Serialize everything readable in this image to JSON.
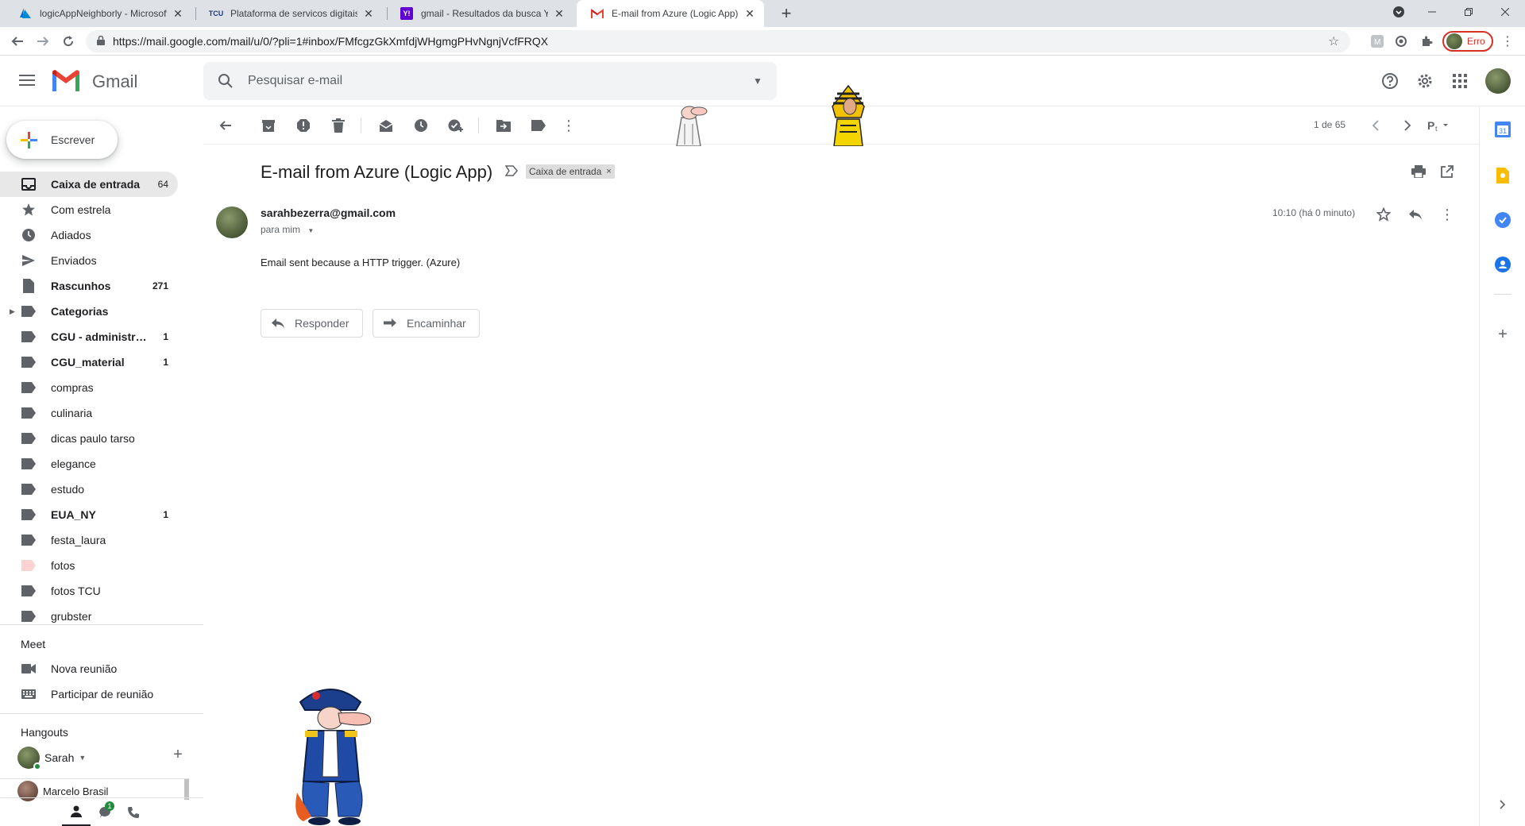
{
  "browser": {
    "tabs": [
      {
        "title": "logicAppNeighborly - Microsoft Azure",
        "favicon": "azure-icon",
        "active": false
      },
      {
        "title": "Plataforma de servicos digitais do TCU",
        "favicon": "tcu-icon",
        "active": false
      },
      {
        "title": "gmail - Resultados da busca Yahoo",
        "favicon": "yahoo-icon",
        "active": false
      },
      {
        "title": "E-mail from Azure (Logic App) - sarahbezerra@gmail.com",
        "favicon": "gmail-icon",
        "active": true
      }
    ],
    "tab_favicon_text": {
      "tcu": "TCU",
      "yahoo": "Y!"
    },
    "url": "https://mail.google.com/mail/u/0/?pli=1#inbox/FMfcgzGkXmfdjWHgmgPHvNgnjVcfFRQX",
    "profile_label": "Erro"
  },
  "gmail": {
    "product_name": "Gmail",
    "search_placeholder": "Pesquisar e-mail",
    "compose_label": "Escrever",
    "nav": [
      {
        "label": "Caixa de entrada",
        "count": "64",
        "icon": "inbox-icon",
        "bold": true,
        "active": true
      },
      {
        "label": "Com estrela",
        "count": "",
        "icon": "star-icon",
        "bold": false
      },
      {
        "label": "Adiados",
        "count": "",
        "icon": "clock-icon",
        "bold": false
      },
      {
        "label": "Enviados",
        "count": "",
        "icon": "send-icon",
        "bold": false
      },
      {
        "label": "Rascunhos",
        "count": "271",
        "icon": "draft-icon",
        "bold": true
      },
      {
        "label": "Categorias",
        "count": "",
        "icon": "label-icon",
        "bold": true,
        "caret": true
      },
      {
        "label": "CGU - administra...",
        "count": "1",
        "icon": "label-icon",
        "bold": true
      },
      {
        "label": "CGU_material",
        "count": "1",
        "icon": "label-icon",
        "bold": true
      },
      {
        "label": "compras",
        "count": "",
        "icon": "label-icon",
        "bold": false
      },
      {
        "label": "culinaria",
        "count": "",
        "icon": "label-icon",
        "bold": false
      },
      {
        "label": "dicas paulo tarso",
        "count": "",
        "icon": "label-icon",
        "bold": false
      },
      {
        "label": "elegance",
        "count": "",
        "icon": "label-icon",
        "bold": false
      },
      {
        "label": "estudo",
        "count": "",
        "icon": "label-icon",
        "bold": false
      },
      {
        "label": "EUA_NY",
        "count": "1",
        "icon": "label-icon",
        "bold": true
      },
      {
        "label": "festa_laura",
        "count": "",
        "icon": "label-icon",
        "bold": false
      },
      {
        "label": "fotos",
        "count": "",
        "icon": "label-pink-icon",
        "bold": false
      },
      {
        "label": "fotos TCU",
        "count": "",
        "icon": "label-icon",
        "bold": false
      },
      {
        "label": "grubster",
        "count": "",
        "icon": "label-icon",
        "bold": false
      }
    ],
    "meet": {
      "heading": "Meet",
      "new_meeting": "Nova reunião",
      "join_meeting": "Participar de reunião"
    },
    "hangouts": {
      "heading": "Hangouts",
      "self_name": "Sarah",
      "contact": "Marcelo Brasil",
      "chat_badge": "1"
    },
    "pager": "1 de 65",
    "message": {
      "subject": "E-mail from Azure (Logic App)",
      "label_chip": "Caixa de entrada",
      "label_chip_close": "×",
      "sender": "sarahbezerra@gmail.com",
      "recipient": "para mim",
      "timestamp": "10:10 (há 0 minuto)",
      "body": "Email sent because a HTTP trigger. (Azure)",
      "reply_label": "Responder",
      "forward_label": "Encaminhar"
    }
  },
  "colors": {
    "gmail_red": "#ea4335",
    "gmail_blue": "#4285f4",
    "gmail_green": "#34a853",
    "gmail_yellow": "#fbbc04",
    "error_red": "#d93025"
  }
}
